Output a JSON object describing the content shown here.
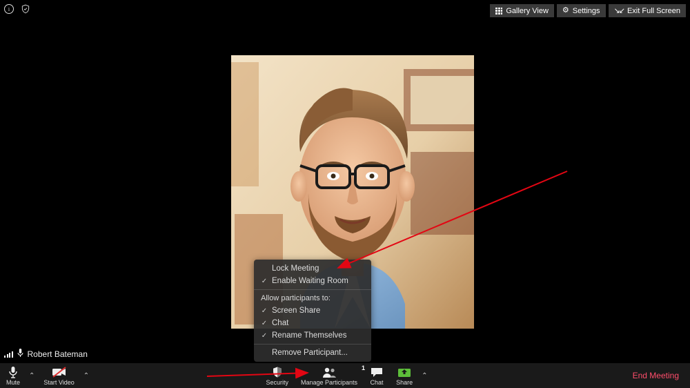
{
  "top": {
    "gallery": "Gallery View",
    "settings": "Settings",
    "exit_full_screen": "Exit Full Screen"
  },
  "participant_name": "Robert Bateman",
  "participant_count": "1",
  "security_menu": {
    "lock_meeting": "Lock Meeting",
    "enable_waiting_room": "Enable Waiting Room",
    "allow_header": "Allow participants to:",
    "screen_share": "Screen Share",
    "chat": "Chat",
    "rename": "Rename Themselves",
    "remove": "Remove Participant..."
  },
  "toolbar": {
    "mute": "Mute",
    "start_video": "Start Video",
    "security": "Security",
    "manage_participants": "Manage Participants",
    "chat": "Chat",
    "share": "Share",
    "end_meeting": "End Meeting"
  }
}
